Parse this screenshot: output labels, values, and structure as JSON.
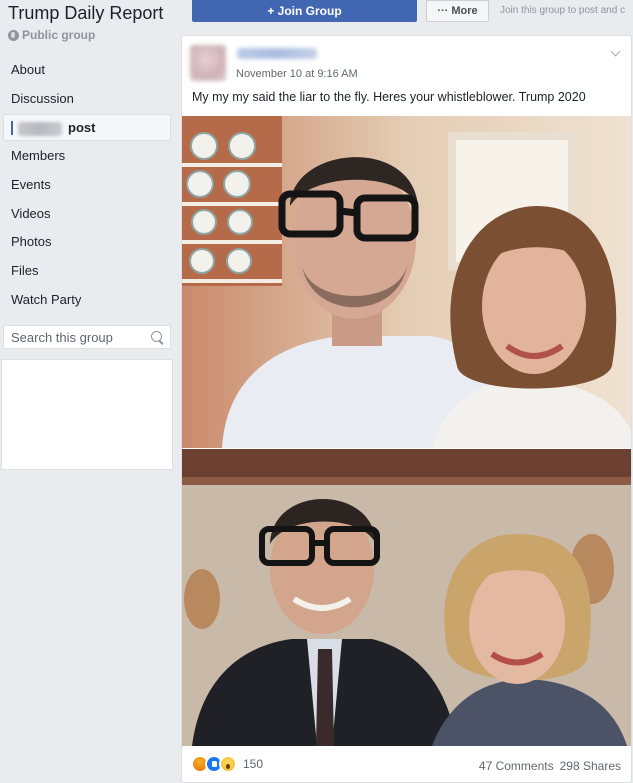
{
  "group": {
    "title": "Trump Daily Report",
    "privacy": "Public group"
  },
  "nav": [
    {
      "label": "About"
    },
    {
      "label": "Discussion"
    },
    {
      "label": "post",
      "active": true
    },
    {
      "label": "Members"
    },
    {
      "label": "Events"
    },
    {
      "label": "Videos"
    },
    {
      "label": "Photos"
    },
    {
      "label": "Files"
    },
    {
      "label": "Watch Party"
    }
  ],
  "search": {
    "placeholder": "Search this group"
  },
  "actions": {
    "join_label": "+ Join Group",
    "more_label": "··· More",
    "join_hint": "Join this group to post and c"
  },
  "post": {
    "timestamp": "November 10 at 9:16 AM",
    "text": "My my my said the liar to the fly. Heres your whistleblower. Trump 2020",
    "reaction_count": "150",
    "comments": "47 Comments",
    "shares": "298 Shares"
  },
  "colors": {
    "brand": "#4267b2",
    "page_bg": "#e9ebee",
    "muted_text": "#606770"
  }
}
